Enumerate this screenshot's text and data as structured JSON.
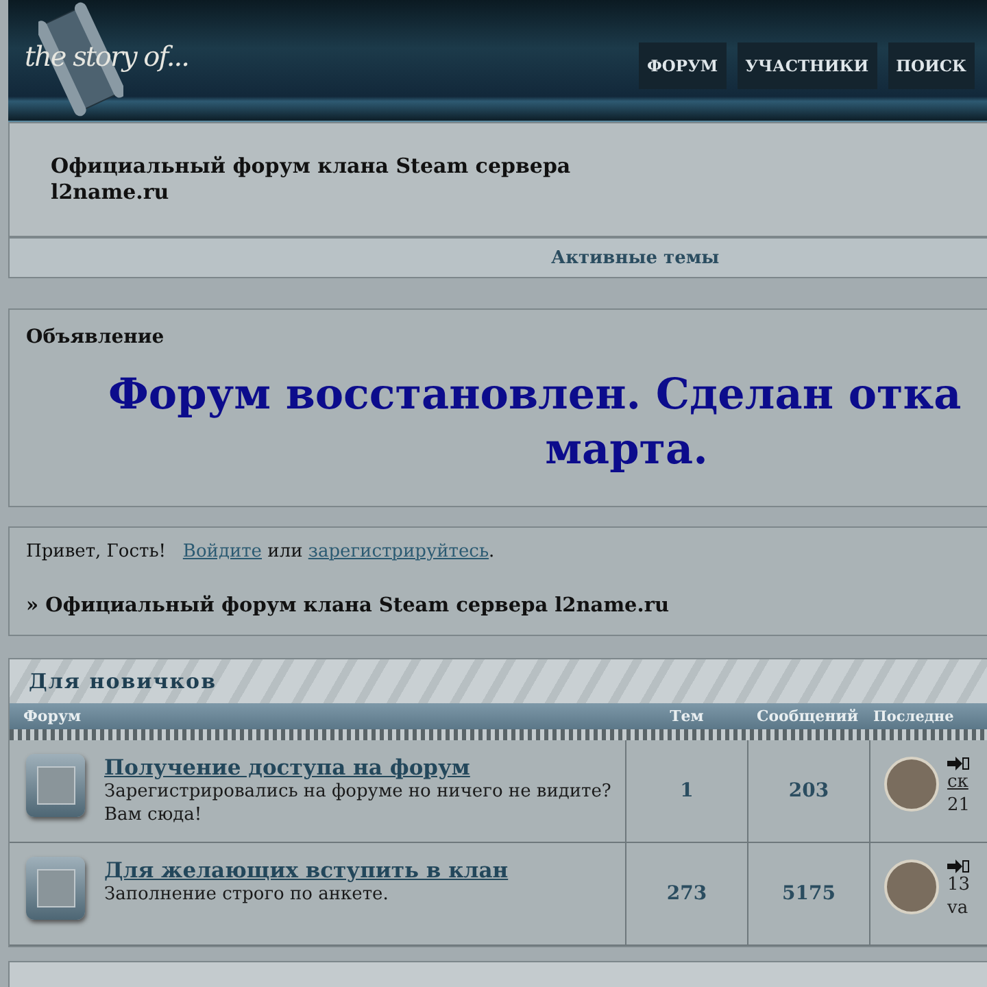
{
  "header": {
    "logo": "the story of...",
    "nav": [
      {
        "label": "ФОРУМ"
      },
      {
        "label": "УЧАСТНИКИ"
      },
      {
        "label": "ПОИСК"
      }
    ]
  },
  "site_title": "Официальный форум клана Steam сервера l2name.ru",
  "active_topics_link": "Активные темы",
  "announcement": {
    "title": "Объявление",
    "lines": [
      "Форум восстановлен. Сделан отка",
      "марта."
    ]
  },
  "welcome": {
    "greeting": "Привет, Гость!",
    "login": "Войдите",
    "or": "или",
    "register": "зарегистрируйтесь",
    "end": "."
  },
  "breadcrumb": "» Официальный форум клана Steam сервера l2name.ru",
  "category": {
    "title": "Для новичков",
    "columns": [
      "Форум",
      "Тем",
      "Сообщений",
      "Последне"
    ],
    "forums": [
      {
        "title": "Получение доступа на форум",
        "description": "Зарегистрировались на форуме но ничего не видите? Вам сюда!",
        "topics": "1",
        "posts": "203",
        "last_lines": [
          "ск",
          "21"
        ],
        "last_link": true
      },
      {
        "title": "Для желающих вступить в клан",
        "description": "Заполнение строго по анкете.",
        "topics": "273",
        "posts": "5175",
        "last_lines": [
          "13",
          "va"
        ],
        "last_link": false
      }
    ]
  }
}
